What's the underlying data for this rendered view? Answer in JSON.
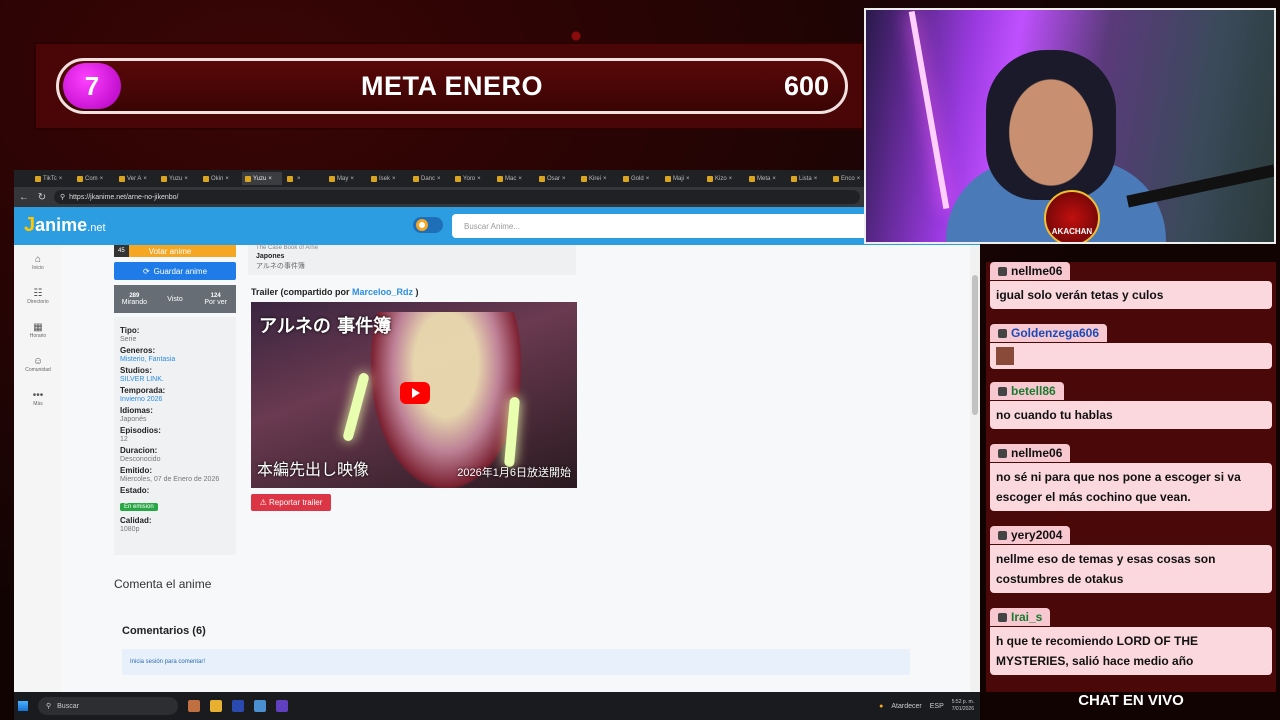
{
  "meta": {
    "count": "7",
    "title": "META ENERO",
    "goal": "600"
  },
  "browser": {
    "tabs": [
      "TikTc",
      "Com",
      "Ver A",
      "Yuzu",
      "Okin",
      "Yuzu",
      "",
      "May",
      "Isek",
      "Danc",
      "Yoro",
      "Mac",
      "Osar",
      "Kirei",
      "Gold",
      "Maji",
      "Kizo",
      "Meta",
      "Lista",
      "Enco"
    ],
    "url": "https://jkanime.net/arne-no-jikenbo/"
  },
  "site": {
    "logo_main": "anime",
    "logo_j": "J",
    "logo_net": ".net",
    "search_placeholder": "Buscar Anime...",
    "nav": [
      {
        "icon": "⌂",
        "label": "Inicio"
      },
      {
        "icon": "☷",
        "label": "Directorio"
      },
      {
        "icon": "▦",
        "label": "Horario"
      },
      {
        "icon": "☺",
        "label": "Comunidad"
      },
      {
        "icon": "•••",
        "label": "Más"
      }
    ]
  },
  "anime": {
    "vote_count": "45",
    "vote_label": "Votar anime",
    "save_label": "Guardar anime",
    "stats": [
      {
        "num": "289",
        "label": "Mirando"
      },
      {
        "num": "",
        "label": "Visto"
      },
      {
        "num": "124",
        "label": "Por ver"
      }
    ],
    "info": [
      {
        "label": "Tipo:",
        "value": "Serie",
        "link": false
      },
      {
        "label": "Generos:",
        "value": "Misterio, Fantasia",
        "link": true
      },
      {
        "label": "Studios:",
        "value": "SILVER LINK.",
        "link": true
      },
      {
        "label": "Temporada:",
        "value": "Invierno 2026",
        "link": true
      },
      {
        "label": "Idiomas:",
        "value": "Japonés",
        "link": false
      },
      {
        "label": "Episodios:",
        "value": "12",
        "link": false
      },
      {
        "label": "Duracion:",
        "value": "Desconocido",
        "link": false
      },
      {
        "label": "Emitido:",
        "value": "Miercoles, 07 de Enero de 2026",
        "link": false
      }
    ],
    "estado_label": "Estado:",
    "estado_value": "En emision",
    "calidad_label": "Calidad:",
    "calidad_value": "1080p",
    "card_title": "The Case Book of Arne",
    "card_lang": "Japones",
    "card_jp": "アルネの事件簿",
    "trailer_prefix": "Trailer (compartido por ",
    "trailer_user": "Marceloo_Rdz",
    "trailer_suffix": " )",
    "video_title_jp": "アルネの 事件簿",
    "video_sub_jp": "本編先出し映像",
    "video_date_jp": "2026年1月6日放送開始",
    "report_label": "Reportar trailer",
    "comenta": "Comenta el anime",
    "comments_title": "Comentarios (6)",
    "login_prompt": "Inicia sesión para comentar!"
  },
  "taskbar": {
    "search": "Buscar",
    "weather": "Atardecer",
    "lang": "ESP",
    "time": "5:52 p. m.",
    "date": "7/01/2026"
  },
  "chat": {
    "messages": [
      {
        "name": "nellme06",
        "text": "igual solo verán tetas y culos",
        "style": "plain"
      },
      {
        "name": "Goldenzega606",
        "text": "",
        "style": "blue"
      },
      {
        "name": "betell86",
        "text": "no cuando tu hablas",
        "style": "green"
      },
      {
        "name": "nellme06",
        "text": "no sé ni para que nos pone a escoger si va escoger el más cochino que vean.",
        "style": "plain"
      },
      {
        "name": "yery2004",
        "text": "nellme eso de temas y esas cosas son costumbres de otakus",
        "style": "plain"
      },
      {
        "name": "Irai_s",
        "text": "h que te recomiendo LORD OF THE MYSTERIES, salió hace medio año",
        "style": "green"
      }
    ],
    "footer": "CHAT EN VIVO"
  },
  "webcam": {
    "badge": "AKACHAN"
  }
}
